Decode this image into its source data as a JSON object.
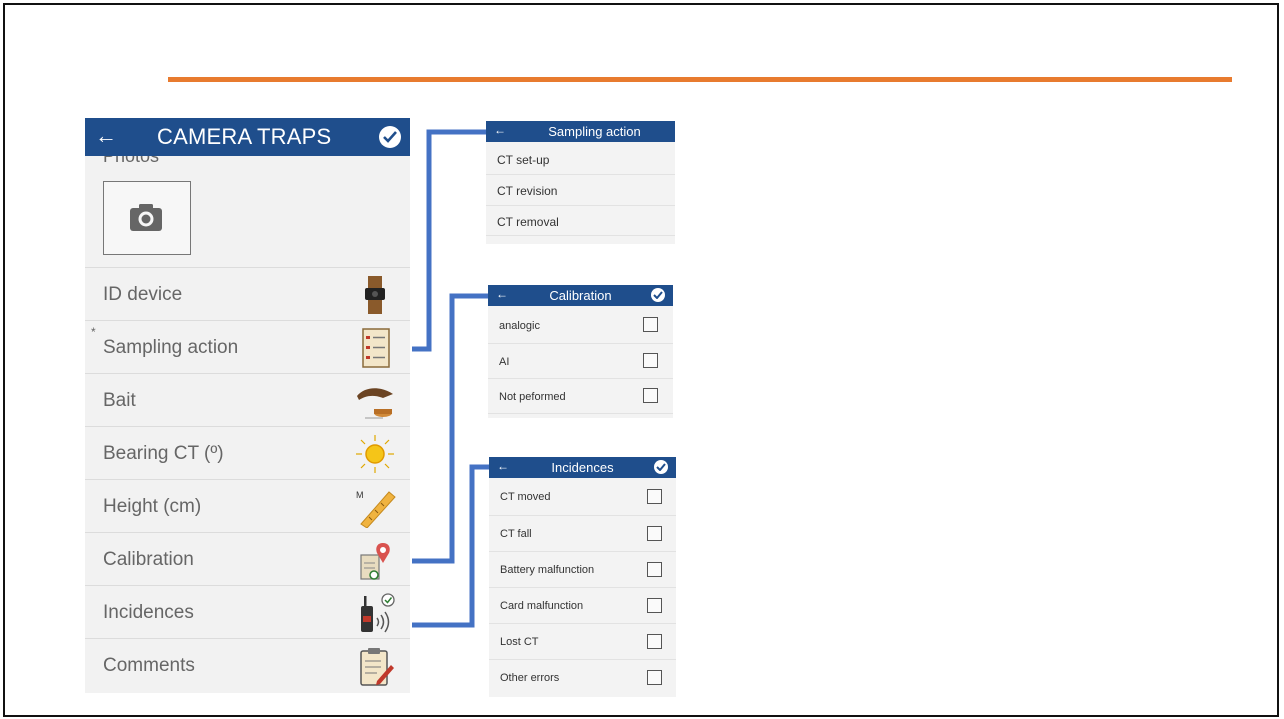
{
  "main": {
    "title": "CAMERA TRAPS",
    "photos_label": "Photos",
    "required_mark": "*",
    "rows": [
      {
        "label": "ID device",
        "icon": "device-icon"
      },
      {
        "label": "Sampling action",
        "icon": "list-icon"
      },
      {
        "label": "Bait",
        "icon": "bait-icon"
      },
      {
        "label": "Bearing CT (º)",
        "icon": "sun-icon"
      },
      {
        "label": "Height (cm)",
        "icon": "ruler-icon"
      },
      {
        "label": "Calibration",
        "icon": "map-pin-clipboard-icon"
      },
      {
        "label": "Incidences",
        "icon": "radio-icon"
      },
      {
        "label": "Comments",
        "icon": "clipboard-pen-icon"
      }
    ],
    "ruler_mark": "M"
  },
  "sampling_panel": {
    "title": "Sampling action",
    "items": [
      "CT set-up",
      "CT revision",
      "CT removal"
    ]
  },
  "calibration_panel": {
    "title": "Calibration",
    "items": [
      "analogic",
      "AI",
      "Not peformed"
    ]
  },
  "incidences_panel": {
    "title": "Incidences",
    "items": [
      "CT moved",
      "CT fall",
      "Battery malfunction",
      "Card malfunction",
      "Lost CT",
      "Other errors"
    ]
  },
  "colors": {
    "accent_bar": "#1f4e8c",
    "orange_rule": "#e87b2f",
    "connector": "#4472c4"
  }
}
